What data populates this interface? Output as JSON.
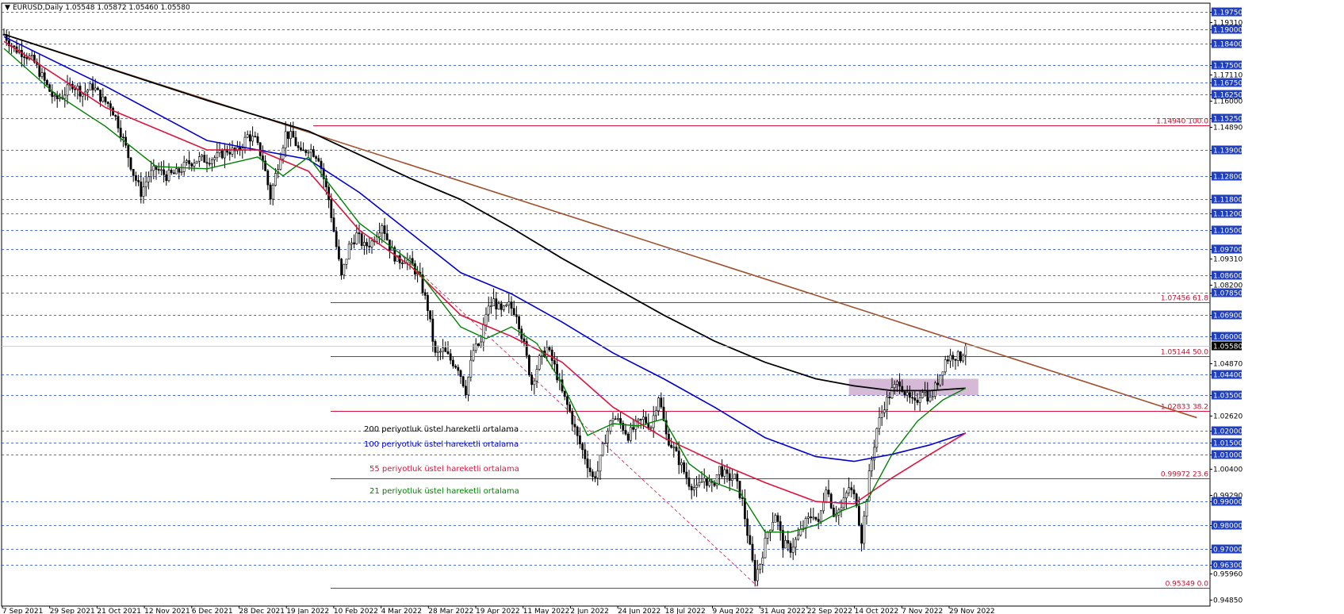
{
  "window": {
    "symbol_line": "EURUSD,Daily  1.05548 1.05872 1.05460 1.05580"
  },
  "chart_data": {
    "type": "candlestick",
    "symbol": "EURUSD",
    "timeframe": "Daily",
    "ohlc_last": {
      "open": 1.05548,
      "high": 1.05872,
      "low": 1.0546,
      "close": 1.0558
    },
    "ylim": [
      0.9485,
      1.1975
    ],
    "current_price": "1.05580",
    "price_ticks": [
      {
        "v": 1.1975,
        "label": "1.19750",
        "grid": true,
        "boxed": true
      },
      {
        "v": 1.1931,
        "label": "1.19310",
        "grid": false,
        "boxed": false
      },
      {
        "v": 1.19,
        "label": "1.19000",
        "grid": true,
        "boxed": true
      },
      {
        "v": 1.184,
        "label": "1.18400",
        "grid": true,
        "boxed": true
      },
      {
        "v": 1.175,
        "label": "1.17500",
        "grid": true,
        "boxed": true
      },
      {
        "v": 1.1711,
        "label": "1.17110",
        "grid": false,
        "boxed": false
      },
      {
        "v": 1.1675,
        "label": "1.16750",
        "grid": true,
        "boxed": true
      },
      {
        "v": 1.1625,
        "label": "1.16250",
        "grid": true,
        "boxed": true
      },
      {
        "v": 1.16,
        "label": "1.16000",
        "grid": false,
        "boxed": false
      },
      {
        "v": 1.1525,
        "label": "1.15250",
        "grid": true,
        "boxed": true
      },
      {
        "v": 1.1489,
        "label": "1.14890",
        "grid": false,
        "boxed": false
      },
      {
        "v": 1.139,
        "label": "1.13900",
        "grid": true,
        "boxed": true
      },
      {
        "v": 1.128,
        "label": "1.12800",
        "grid": true,
        "boxed": true
      },
      {
        "v": 1.118,
        "label": "1.11800",
        "grid": true,
        "boxed": true
      },
      {
        "v": 1.112,
        "label": "1.11200",
        "grid": true,
        "boxed": true
      },
      {
        "v": 1.105,
        "label": "1.10500",
        "grid": true,
        "boxed": true
      },
      {
        "v": 1.097,
        "label": "1.09700",
        "grid": true,
        "boxed": true
      },
      {
        "v": 1.0931,
        "label": "1.09310",
        "grid": false,
        "boxed": false
      },
      {
        "v": 1.086,
        "label": "1.08600",
        "grid": true,
        "boxed": true
      },
      {
        "v": 1.082,
        "label": "1.08200",
        "grid": false,
        "boxed": false
      },
      {
        "v": 1.0785,
        "label": "1.07850",
        "grid": true,
        "boxed": true
      },
      {
        "v": 1.069,
        "label": "1.06900",
        "grid": true,
        "boxed": true
      },
      {
        "v": 1.06,
        "label": "1.06000",
        "grid": true,
        "boxed": true
      },
      {
        "v": 1.0487,
        "label": "1.04870",
        "grid": false,
        "boxed": false
      },
      {
        "v": 1.044,
        "label": "1.04400",
        "grid": true,
        "boxed": true
      },
      {
        "v": 1.035,
        "label": "1.03500",
        "grid": true,
        "boxed": true
      },
      {
        "v": 1.0262,
        "label": "1.02620",
        "grid": false,
        "boxed": false
      },
      {
        "v": 1.02,
        "label": "1.02000",
        "grid": true,
        "boxed": true
      },
      {
        "v": 1.015,
        "label": "1.01500",
        "grid": true,
        "boxed": true
      },
      {
        "v": 1.01,
        "label": "1.01000",
        "grid": true,
        "boxed": true
      },
      {
        "v": 1.004,
        "label": "1.00400",
        "grid": false,
        "boxed": false
      },
      {
        "v": 0.9929,
        "label": "0.99290",
        "grid": false,
        "boxed": false
      },
      {
        "v": 0.99,
        "label": "0.99000",
        "grid": true,
        "boxed": true
      },
      {
        "v": 0.98,
        "label": "0.98000",
        "grid": true,
        "boxed": true
      },
      {
        "v": 0.97,
        "label": "0.97000",
        "grid": true,
        "boxed": true
      },
      {
        "v": 0.963,
        "label": "0.96300",
        "grid": true,
        "boxed": true
      },
      {
        "v": 0.9596,
        "label": "0.95960",
        "grid": false,
        "boxed": false
      },
      {
        "v": 0.9485,
        "label": "0.94850",
        "grid": false,
        "boxed": false
      }
    ],
    "date_labels": [
      "7 Sep 2021",
      "29 Sep 2021",
      "21 Oct 2021",
      "12 Nov 2021",
      "6 Dec 2021",
      "28 Dec 2021",
      "19 Jan 2022",
      "10 Feb 2022",
      "4 Mar 2022",
      "28 Mar 2022",
      "19 Apr 2022",
      "11 May 2022",
      "2 Jun 2022",
      "24 Jun 2022",
      "18 Jul 2022",
      "9 Aug 2022",
      "31 Aug 2022",
      "22 Sep 2022",
      "14 Oct 2022",
      "7 Nov 2022",
      "29 Nov 2022"
    ],
    "fib_levels": [
      {
        "v": 1.1494,
        "label": "1.14940 100.0"
      },
      {
        "v": 1.07456,
        "label": "1.07456 61.8"
      },
      {
        "v": 1.05144,
        "label": "1.05144 50.0"
      },
      {
        "v": 1.02833,
        "label": "1.02833 38.2"
      },
      {
        "v": 0.99972,
        "label": "0.99972 23.6"
      },
      {
        "v": 0.95349,
        "label": "0.95349 0.0"
      }
    ],
    "price_path": [
      [
        0,
        1.188
      ],
      [
        4,
        1.182
      ],
      [
        8,
        1.18
      ],
      [
        12,
        1.176
      ],
      [
        16,
        1.168
      ],
      [
        20,
        1.16
      ],
      [
        23,
        1.162
      ],
      [
        27,
        1.167
      ],
      [
        31,
        1.163
      ],
      [
        35,
        1.166
      ],
      [
        39,
        1.16
      ],
      [
        42,
        1.158
      ],
      [
        45,
        1.15
      ],
      [
        48,
        1.14
      ],
      [
        51,
        1.129
      ],
      [
        54,
        1.121
      ],
      [
        57,
        1.128
      ],
      [
        60,
        1.131
      ],
      [
        64,
        1.128
      ],
      [
        68,
        1.129
      ],
      [
        72,
        1.133
      ],
      [
        76,
        1.135
      ],
      [
        80,
        1.135
      ],
      [
        84,
        1.136
      ],
      [
        88,
        1.139
      ],
      [
        92,
        1.138
      ],
      [
        96,
        1.145
      ],
      [
        99,
        1.143
      ],
      [
        102,
        1.135
      ],
      [
        105,
        1.119
      ],
      [
        108,
        1.133
      ],
      [
        111,
        1.146
      ],
      [
        114,
        1.144
      ],
      [
        117,
        1.137
      ],
      [
        120,
        1.14
      ],
      [
        124,
        1.136
      ],
      [
        128,
        1.118
      ],
      [
        131,
        1.098
      ],
      [
        133,
        1.085
      ],
      [
        136,
        1.098
      ],
      [
        139,
        1.103
      ],
      [
        142,
        1.098
      ],
      [
        145,
        1.1
      ],
      [
        149,
        1.108
      ],
      [
        152,
        1.098
      ],
      [
        155,
        1.092
      ],
      [
        158,
        1.093
      ],
      [
        161,
        1.09
      ],
      [
        164,
        1.084
      ],
      [
        167,
        1.072
      ],
      [
        170,
        1.052
      ],
      [
        173,
        1.054
      ],
      [
        176,
        1.05
      ],
      [
        179,
        1.047
      ],
      [
        182,
        1.037
      ],
      [
        185,
        1.054
      ],
      [
        188,
        1.057
      ],
      [
        190,
        1.07
      ],
      [
        193,
        1.075
      ],
      [
        196,
        1.07
      ],
      [
        199,
        1.073
      ],
      [
        202,
        1.07
      ],
      [
        205,
        1.056
      ],
      [
        208,
        1.04
      ],
      [
        211,
        1.05
      ],
      [
        214,
        1.055
      ],
      [
        217,
        1.047
      ],
      [
        220,
        1.036
      ],
      [
        223,
        1.028
      ],
      [
        226,
        1.017
      ],
      [
        229,
        1.009
      ],
      [
        232,
        1.0
      ],
      [
        234,
        1.003
      ],
      [
        237,
        1.017
      ],
      [
        240,
        1.026
      ],
      [
        243,
        1.023
      ],
      [
        246,
        1.018
      ],
      [
        249,
        1.022
      ],
      [
        252,
        1.025
      ],
      [
        255,
        1.022
      ],
      [
        258,
        1.035
      ],
      [
        261,
        1.018
      ],
      [
        264,
        1.012
      ],
      [
        267,
        1.005
      ],
      [
        270,
        0.998
      ],
      [
        273,
        0.995
      ],
      [
        276,
        1.0
      ],
      [
        279,
        0.996
      ],
      [
        282,
        1.004
      ],
      [
        285,
        1.0
      ],
      [
        288,
        1.0
      ],
      [
        291,
        0.99
      ],
      [
        294,
        0.97
      ],
      [
        296,
        0.958
      ],
      [
        298,
        0.964
      ],
      [
        301,
        0.977
      ],
      [
        304,
        0.985
      ],
      [
        307,
        0.972
      ],
      [
        310,
        0.97
      ],
      [
        313,
        0.975
      ],
      [
        316,
        0.981
      ],
      [
        319,
        0.985
      ],
      [
        321,
        0.98
      ],
      [
        324,
        0.997
      ],
      [
        327,
        0.985
      ],
      [
        330,
        0.987
      ],
      [
        333,
        0.996
      ],
      [
        336,
        0.99
      ],
      [
        338,
        0.974
      ],
      [
        341,
        1.001
      ],
      [
        344,
        1.021
      ],
      [
        347,
        1.031
      ],
      [
        350,
        1.037
      ],
      [
        353,
        1.041
      ],
      [
        356,
        1.034
      ],
      [
        359,
        1.031
      ],
      [
        362,
        1.038
      ],
      [
        365,
        1.033
      ],
      [
        368,
        1.041
      ],
      [
        371,
        1.05
      ],
      [
        374,
        1.052
      ],
      [
        377,
        1.051
      ],
      [
        379,
        1.056
      ]
    ],
    "ema200": [
      [
        0,
        1.188
      ],
      [
        40,
        1.174
      ],
      [
        80,
        1.16
      ],
      [
        120,
        1.147
      ],
      [
        160,
        1.127
      ],
      [
        180,
        1.118
      ],
      [
        200,
        1.106
      ],
      [
        220,
        1.093
      ],
      [
        240,
        1.081
      ],
      [
        260,
        1.069
      ],
      [
        280,
        1.058
      ],
      [
        300,
        1.049
      ],
      [
        320,
        1.042
      ],
      [
        335,
        1.039
      ],
      [
        350,
        1.037
      ],
      [
        365,
        1.037
      ],
      [
        379,
        1.038
      ]
    ],
    "ema100": [
      [
        0,
        1.187
      ],
      [
        40,
        1.166
      ],
      [
        80,
        1.143
      ],
      [
        120,
        1.135
      ],
      [
        140,
        1.121
      ],
      [
        160,
        1.104
      ],
      [
        180,
        1.087
      ],
      [
        200,
        1.078
      ],
      [
        220,
        1.066
      ],
      [
        240,
        1.053
      ],
      [
        260,
        1.042
      ],
      [
        280,
        1.03
      ],
      [
        300,
        1.017
      ],
      [
        320,
        1.009
      ],
      [
        335,
        1.007
      ],
      [
        350,
        1.01
      ],
      [
        365,
        1.014
      ],
      [
        379,
        1.019
      ]
    ],
    "ema55": [
      [
        0,
        1.185
      ],
      [
        40,
        1.157
      ],
      [
        80,
        1.139
      ],
      [
        100,
        1.139
      ],
      [
        120,
        1.13
      ],
      [
        140,
        1.105
      ],
      [
        160,
        1.09
      ],
      [
        180,
        1.069
      ],
      [
        200,
        1.06
      ],
      [
        220,
        1.049
      ],
      [
        240,
        1.03
      ],
      [
        260,
        1.017
      ],
      [
        280,
        1.007
      ],
      [
        300,
        0.998
      ],
      [
        320,
        0.99
      ],
      [
        335,
        0.989
      ],
      [
        350,
        1.0
      ],
      [
        365,
        1.01
      ],
      [
        379,
        1.019
      ]
    ],
    "ema21": [
      [
        0,
        1.182
      ],
      [
        20,
        1.163
      ],
      [
        40,
        1.149
      ],
      [
        60,
        1.132
      ],
      [
        80,
        1.131
      ],
      [
        100,
        1.136
      ],
      [
        110,
        1.128
      ],
      [
        120,
        1.136
      ],
      [
        140,
        1.108
      ],
      [
        160,
        1.092
      ],
      [
        180,
        1.064
      ],
      [
        190,
        1.059
      ],
      [
        200,
        1.064
      ],
      [
        210,
        1.057
      ],
      [
        220,
        1.04
      ],
      [
        230,
        1.018
      ],
      [
        240,
        1.023
      ],
      [
        250,
        1.022
      ],
      [
        260,
        1.025
      ],
      [
        270,
        1.006
      ],
      [
        280,
        0.998
      ],
      [
        290,
        0.994
      ],
      [
        300,
        0.977
      ],
      [
        310,
        0.977
      ],
      [
        320,
        0.98
      ],
      [
        330,
        0.986
      ],
      [
        340,
        0.99
      ],
      [
        350,
        1.01
      ],
      [
        360,
        1.024
      ],
      [
        370,
        1.033
      ],
      [
        379,
        1.038
      ]
    ],
    "trendline": {
      "from": [
        0,
        1.188
      ],
      "to": [
        379,
        1.057
      ],
      "extend_to": 1.0255
    },
    "dashed_line": {
      "from": [
        157,
        1.094
      ],
      "to": [
        297,
        0.954
      ]
    },
    "zone": {
      "x0": 333,
      "x1": 384,
      "y_top": 1.042,
      "y_bottom": 1.035
    },
    "legend": [
      {
        "text": "200 periyotluk üstel hareketli ortalama",
        "color": "#000000"
      },
      {
        "text": "100 periyotluk üstel hareketli ortalama",
        "color": "#0000cd"
      },
      {
        "text": "55 periyotluk üstel hareketli ortalama",
        "color": "#dc143c"
      },
      {
        "text": "21 periyotluk üstel hareketli ortalama",
        "color": "#008000"
      }
    ],
    "colors": {
      "ema200": "#000000",
      "ema100": "#0000cd",
      "ema55": "#dc143c",
      "ema21": "#008000",
      "trendline": "#a0522d",
      "fib": "#dc143c",
      "grid": "#1f3fbf",
      "zone": "#c8a2c8",
      "candle": "#000000"
    }
  }
}
